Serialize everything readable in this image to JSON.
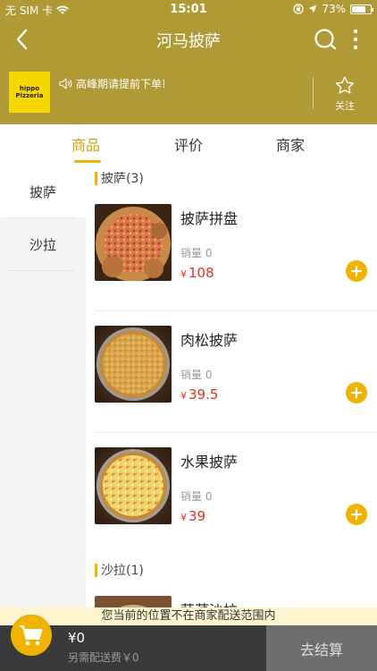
{
  "status_bar": {
    "carrier": "无 SIM 卡",
    "time": "15:01",
    "battery": "73%",
    "battery_level": 0.73
  },
  "nav": {
    "title": "河马披萨",
    "back_icon": "back-chevron-icon",
    "search_icon": "search-icon",
    "more_icon": "more-vertical-icon"
  },
  "shop": {
    "logo_lines": [
      "hippo",
      "Pizzeria"
    ],
    "notice": "高峰期请提前下单!",
    "follow_label": "关注"
  },
  "tabs": [
    {
      "label": "商品",
      "active": true
    },
    {
      "label": "评价",
      "active": false
    },
    {
      "label": "商家",
      "active": false
    }
  ],
  "sidebar": {
    "items": [
      {
        "label": "披萨",
        "active": true
      },
      {
        "label": "沙拉",
        "active": false
      }
    ]
  },
  "sections": [
    {
      "title": "披萨(3)",
      "products": [
        {
          "name": "披萨拼盘",
          "sales": "销量 0",
          "currency": "¥",
          "price": "108"
        },
        {
          "name": "肉松披萨",
          "sales": "销量 0",
          "currency": "¥",
          "price": "39.5"
        },
        {
          "name": "水果披萨",
          "sales": "销量 0",
          "currency": "¥",
          "price": "39"
        }
      ]
    },
    {
      "title": "沙拉(1)",
      "products": [
        {
          "name": "蔬菜沙拉"
        }
      ]
    }
  ],
  "notice_bar": "您当前的位置不在商家配送范围内",
  "cart": {
    "amount": "¥0",
    "delivery_fee": "另需配送费￥0",
    "checkout_label": "去结算"
  },
  "colors": {
    "header_bg": "#b09a36",
    "accent": "#f0b300",
    "price": "#e53020",
    "cart_bg": "#3a3a3a",
    "checkout_bg": "#6e6e6e"
  }
}
